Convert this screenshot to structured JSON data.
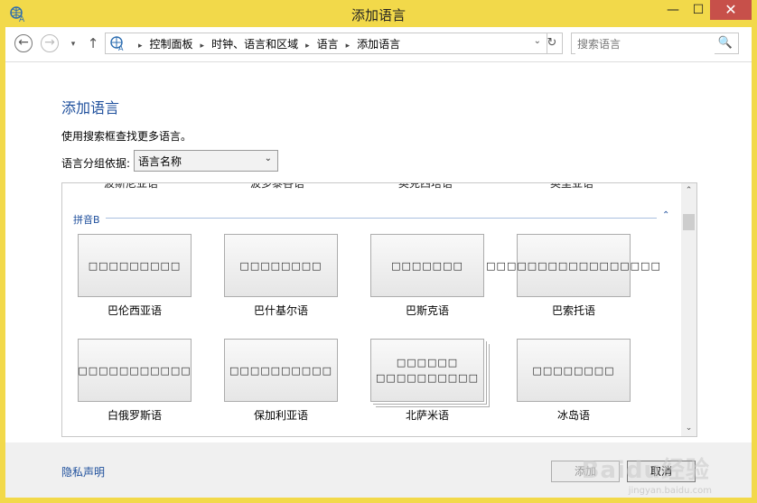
{
  "window": {
    "title": "添加语言",
    "app_icon": "language-globe-icon",
    "controls": {
      "minimize": "—",
      "maximize": "☐",
      "close": "✕"
    }
  },
  "navbar": {
    "back": "←",
    "forward": "→",
    "recent": "▾",
    "up": "↑",
    "breadcrumbs": [
      "控制面板",
      "时钟、语言和区域",
      "语言",
      "添加语言"
    ],
    "separator": "▸",
    "dropdown": "⌄",
    "refresh": "↻",
    "search_placeholder": "搜索语言",
    "search_icon": "🔍"
  },
  "main": {
    "heading": "添加语言",
    "hint": "使用搜索框查找更多语言。",
    "group_label": "语言分组依据:",
    "group_select_value": "语言名称",
    "group_select_arrow": "⌄"
  },
  "list": {
    "cut_row": [
      "波斯尼亚语",
      "波多黎各语",
      "奥克西塔语",
      "奥里亚语"
    ],
    "group_header": "拼音B",
    "group_toggle": "⌃",
    "tiles": [
      {
        "box": "□□□□□□□□□",
        "name": "巴伦西亚语"
      },
      {
        "box": "□□□□□□□□",
        "name": "巴什基尔语"
      },
      {
        "box": "□□□□□□□",
        "name": "巴斯克语"
      },
      {
        "box": "□□□□□□□□□□□□□□□□□",
        "name": "巴索托语"
      },
      {
        "box": "□□□□□□□□□□□",
        "name": "白俄罗斯语"
      },
      {
        "box": "□□□□□□□□□□",
        "name": "保加利亚语"
      },
      {
        "box": "□□□□□□ □□□□□□□□□□",
        "name": "北萨米语"
      },
      {
        "box": "□□□□□□□□",
        "name": "冰岛语"
      }
    ],
    "scroll_up": "⌃",
    "scroll_down": "⌄"
  },
  "footer": {
    "privacy": "隐私声明",
    "add": "添加",
    "cancel": "取消",
    "watermark": "Baidu经验",
    "watermark_url": "jingyan.baidu.com"
  }
}
